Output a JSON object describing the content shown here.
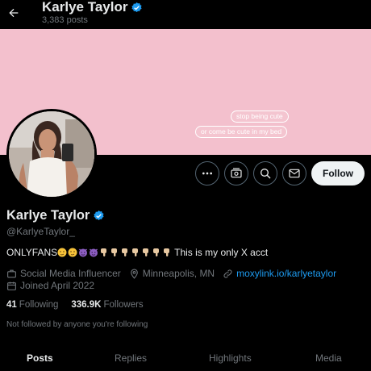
{
  "header": {
    "title": "Karlye Taylor",
    "posts_count": "3,383 posts"
  },
  "banner": {
    "background": "#f3c0cd",
    "chip1": "stop being cute",
    "chip2": "or come be cute in my bed"
  },
  "profile": {
    "name": "Karlye Taylor",
    "handle": "@KarlyeTaylor_",
    "bio_prefix": "ONLYFANS",
    "bio_emojis": [
      "smirk",
      "smirk",
      "devil",
      "devil",
      "point-down",
      "point-down",
      "point-down",
      "point-down",
      "point-down",
      "point-down",
      "point-down"
    ],
    "bio_text": "This is my only X acct",
    "category": "Social Media Influencer",
    "location": "Minneapolis, MN",
    "link": "moxylink.io/karlyetaylor",
    "joined": "Joined April 2022",
    "following_count": "41",
    "following_label": "Following",
    "followers_count": "336.9K",
    "followers_label": "Followers",
    "not_followed": "Not followed by anyone you're following"
  },
  "actions": {
    "follow_label": "Follow"
  },
  "tabs": [
    {
      "label": "Posts",
      "active": true
    },
    {
      "label": "Replies",
      "active": false
    },
    {
      "label": "Highlights",
      "active": false
    },
    {
      "label": "Media",
      "active": false
    }
  ],
  "colors": {
    "accent": "#1d9bf0",
    "verified": "#1d9bf0",
    "muted": "#71767b"
  }
}
